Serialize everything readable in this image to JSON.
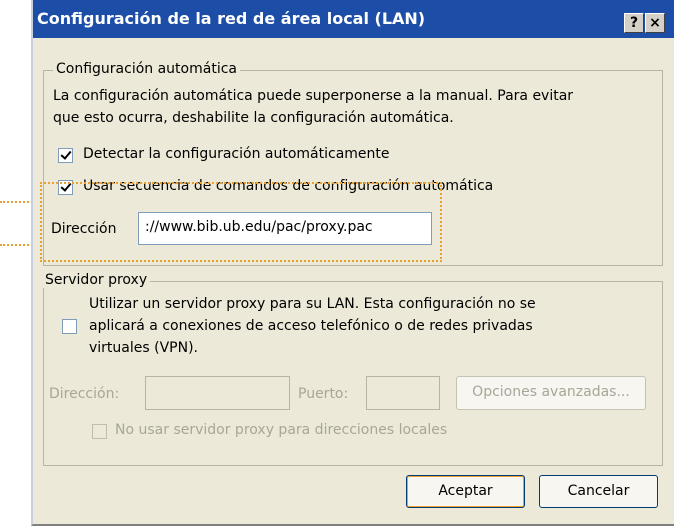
{
  "window": {
    "title": "Configuración de la red de área local (LAN)",
    "help_button": "?",
    "close_button": "×"
  },
  "auto_config": {
    "legend": "Configuración automática",
    "description_line1": "La configuración automática puede superponerse a la manual. Para evitar",
    "description_line2": "que esto ocurra, deshabilite la configuración automática.",
    "detect_label": "Detectar la configuración automáticamente",
    "detect_checked": true,
    "script_label": "Usar secuencia de comandos de configuración automática",
    "script_checked": true,
    "address_label": "Dirección",
    "address_value": "://www.bib.ub.edu/pac/proxy.pac"
  },
  "proxy": {
    "legend": "Servidor proxy",
    "use_proxy_line1": "Utilizar un servidor proxy para su LAN. Esta configuración no se",
    "use_proxy_line2": "aplicará a conexiones de acceso telefónico o de redes privadas",
    "use_proxy_line3": "virtuales (VPN).",
    "use_proxy_checked": false,
    "address_label": "Dirección:",
    "address_value": "",
    "port_label": "Puerto:",
    "port_value": "",
    "advanced_button": "Opciones avanzadas...",
    "bypass_label": "No usar servidor proxy para direcciones locales",
    "bypass_checked": false
  },
  "buttons": {
    "ok": "Aceptar",
    "cancel": "Cancelar"
  },
  "colors": {
    "titlebar": "#1c4ea8",
    "dialog_bg": "#ece9d8",
    "annotation": "#e8a030"
  }
}
